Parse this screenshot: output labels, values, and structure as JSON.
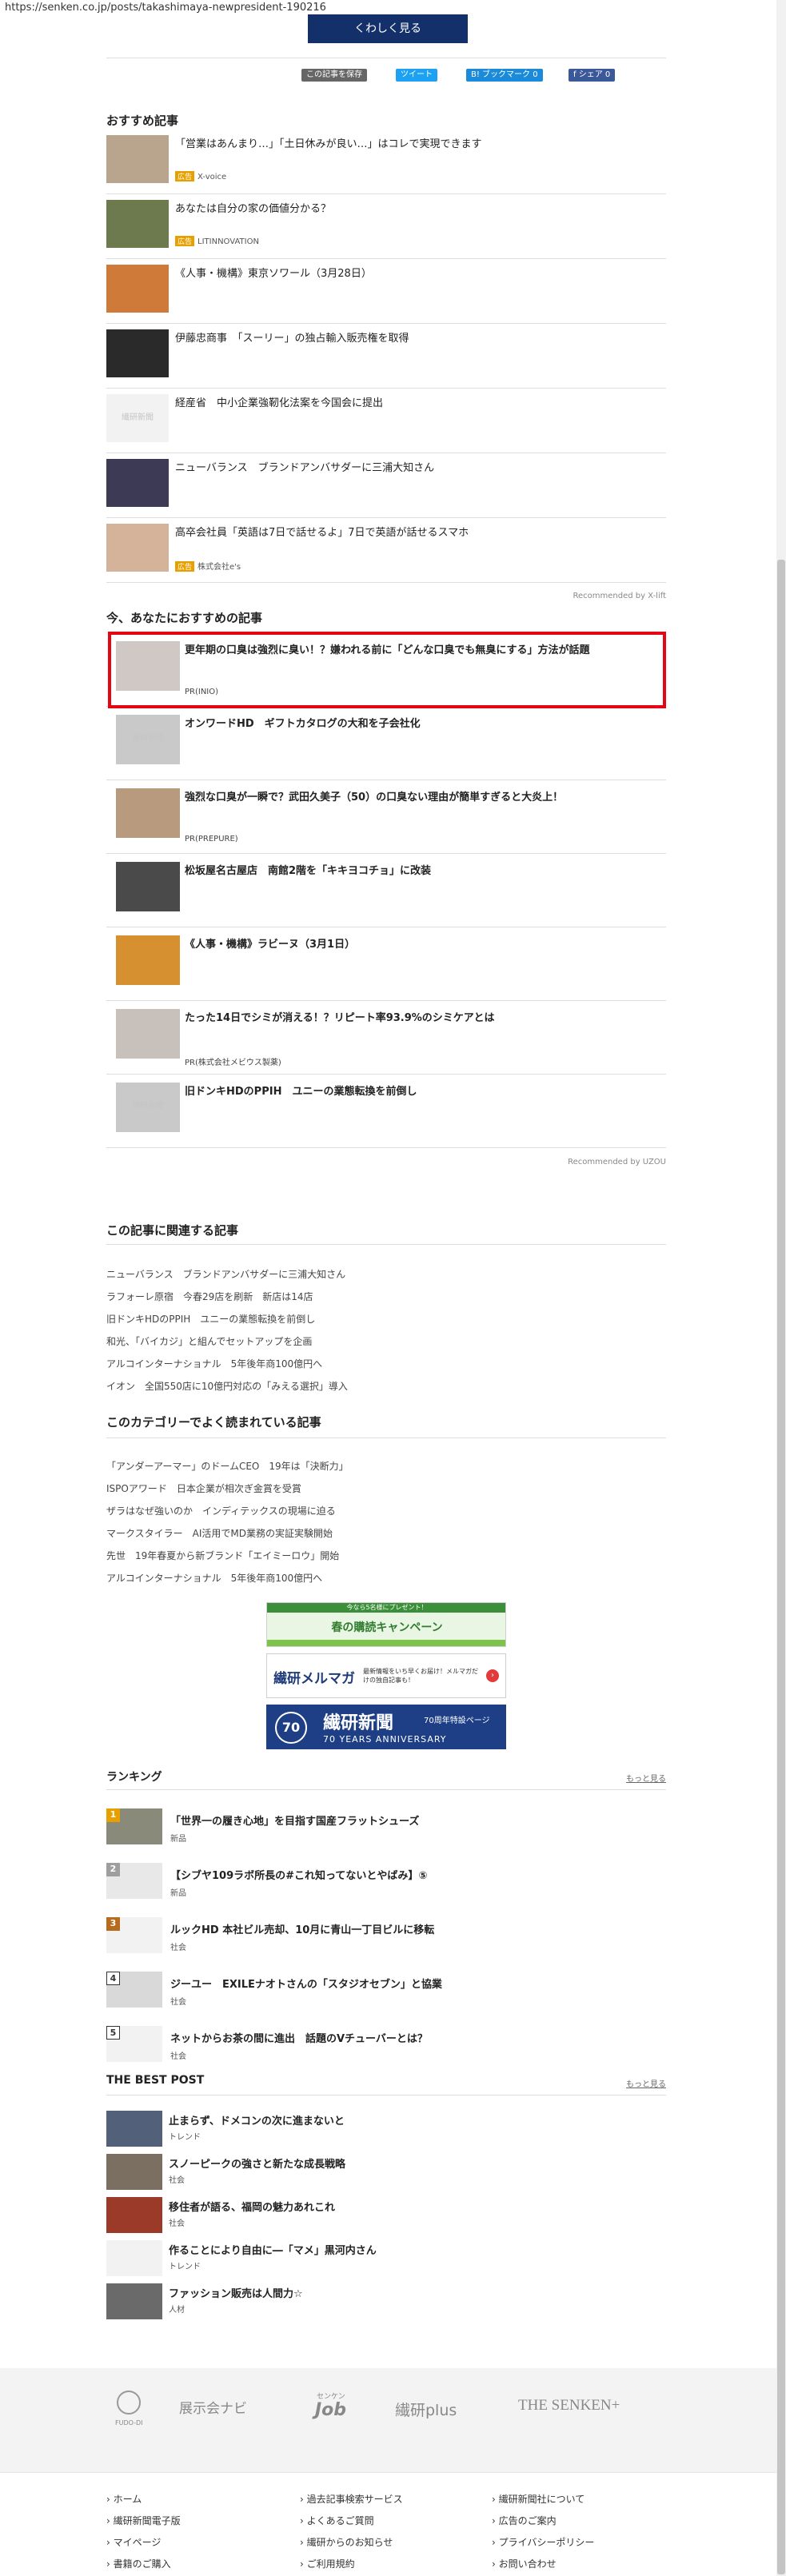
{
  "url": "https://senken.co.jp/posts/takashimaya-newpresident-190216",
  "more_button": "くわしく見る",
  "share": {
    "save": "この記事を保存",
    "tweet": "ツイート",
    "hatena": "B! ブックマーク 0",
    "facebook": "f  シェア 0"
  },
  "recommended": {
    "title": "おすすめ記事",
    "items": [
      {
        "title": "「営業はあんまり…」「土日休みが良い…」はコレで実現できます",
        "badge": "広告",
        "sponsor": "X-voice"
      },
      {
        "title": "あなたは自分の家の価値分かる？",
        "badge": "広告",
        "sponsor": "LITINNOVATION"
      },
      {
        "title": "《人事・機構》東京ソワール（3月28日）",
        "badge": "",
        "sponsor": ""
      },
      {
        "title": "伊藤忠商事　「スーリー」の独占輸入販売権を取得",
        "badge": "",
        "sponsor": ""
      },
      {
        "title": "経産省　中小企業強靭化法案を今国会に提出",
        "badge": "",
        "sponsor": ""
      },
      {
        "title": "ニューバランス　ブランドアンバサダーに三浦大知さん",
        "badge": "",
        "sponsor": ""
      },
      {
        "title": "高卒会社員「英語は7日で話せるよ」7日で英語が話せるスマホ",
        "badge": "広告",
        "sponsor": "株式会社e's"
      }
    ],
    "placeholder": "繊研新聞",
    "recommended_by": "Recommended by  X-lift"
  },
  "for_you": {
    "title": "今、あなたにおすすめの記事",
    "items": [
      {
        "title": "更年期の口臭は強烈に臭い！？嫌われる前に「どんな口臭でも無臭にする」方法が話題",
        "sponsor": "PR(INIO)"
      },
      {
        "title": "オンワードHD　ギフトカタログの大和を子会社化",
        "sponsor": ""
      },
      {
        "title": "強烈な口臭が一瞬で？武田久美子（50）の口臭ない理由が簡単すぎると大炎上！",
        "sponsor": "PR(PREPURE)"
      },
      {
        "title": "松坂屋名古屋店　南館2階を「キキヨコチョ」に改装",
        "sponsor": ""
      },
      {
        "title": "《人事・機構》ラビーヌ（3月1日）",
        "sponsor": ""
      },
      {
        "title": "たった14日でシミが消える！？リピート率93.9%のシミケアとは",
        "sponsor": "PR(株式会社メビウス製薬)"
      },
      {
        "title": "旧ドンキHDのPPIH　ユニーの業態転換を前倒し",
        "sponsor": ""
      }
    ],
    "recommended_by": "Recommended by  UZOU"
  },
  "related": {
    "title": "この記事に関連する記事",
    "links": [
      "ニューバランス　ブランドアンバサダーに三浦大知さん",
      "ラフォーレ原宿　今春29店を刷新　新店は14店",
      "旧ドンキHDのPPIH　ユニーの業態転換を前倒し",
      "和光、「バイカジ」と組んでセットアップを企画",
      "アルコインターナショナル　5年後年商100億円へ",
      "イオン　全国550店に10億円対応の「みえる選択」導入"
    ]
  },
  "category": {
    "title": "このカテゴリーでよく読まれている記事",
    "links": [
      "「アンダーアーマー」のドームCEO　19年は「決断力」",
      "ISPOアワード　日本企業が相次ぎ金賞を受賞",
      "ザラはなぜ強いのか　インディテックスの現場に迫る",
      "マークスタイラー　AI活用でMD業務の実証実験開始",
      "先世　19年春夏から新ブランド「エイミーロウ」開始",
      "アルコインターナショナル　5年後年商100億円へ"
    ]
  },
  "banners": {
    "spring_top": "今なら5名様にプレゼント！",
    "spring": "春の購読キャンペーン",
    "merumaga": "繊研メルマガ",
    "merumaga_sub": "最新情報をいち早くお届け！メルマガだけの独自記事も！",
    "anniv_num": "70",
    "anniv_title": "繊研新聞",
    "anniv_sub": "70周年特設ページ",
    "anniv_en": "70 YEARS ANNIVERSARY"
  },
  "ranking": {
    "title": "ランキング",
    "more": "もっと見る",
    "items": [
      {
        "num": "1",
        "title": "「世界一の履き心地」を目指す国産フラットシューズ",
        "cat": "新品"
      },
      {
        "num": "2",
        "title": "【シブヤ109ラボ所長の#これ知ってないとやばみ】⑤",
        "cat": "新品"
      },
      {
        "num": "3",
        "title": "ルックHD 本社ビル売却、10月に青山一丁目ビルに移転",
        "cat": "社会"
      },
      {
        "num": "4",
        "title": "ジーユー　EXILEナオトさんの「スタジオセブン」と協業",
        "cat": "社会"
      },
      {
        "num": "5",
        "title": "ネットからお茶の間に進出　話題のVチューバーとは？",
        "cat": "社会"
      }
    ]
  },
  "best_post": {
    "title": "THE BEST POST",
    "more": "もっと見る",
    "items": [
      {
        "title": "止まらず、ドメコンの次に進まないと",
        "cat": "トレンド"
      },
      {
        "title": "スノーピークの強さと新たな成長戦略",
        "cat": "社会"
      },
      {
        "title": "移住者が語る、福岡の魅力あれこれ",
        "cat": "社会"
      },
      {
        "title": "作ることにより自由に―「マメ」黒河内さん",
        "cat": "トレンド"
      },
      {
        "title": "ファッション販売は人間力☆",
        "cat": "人材"
      }
    ]
  },
  "footer_logos": {
    "fudo": "FUDO-DI",
    "navi": "展示会ナビ",
    "job": "Job",
    "job_top": "センケン",
    "senken": "繊研plus",
    "the_senken": "THE SENKEN+"
  },
  "footer_links": {
    "col1": [
      "ホーム",
      "繊研新聞電子版",
      "マイページ",
      "書籍のご購入"
    ],
    "col2": [
      "過去記事検索サービス",
      "よくあるご質問",
      "繊研からのお知らせ",
      "ご利用規約"
    ],
    "col3": [
      "繊研新聞社について",
      "広告のご案内",
      "プライバシーポリシー",
      "お問い合わせ"
    ]
  },
  "colors": {
    "accent": "#13306b",
    "highlight": "#e30613",
    "badge": "#e8a000"
  }
}
